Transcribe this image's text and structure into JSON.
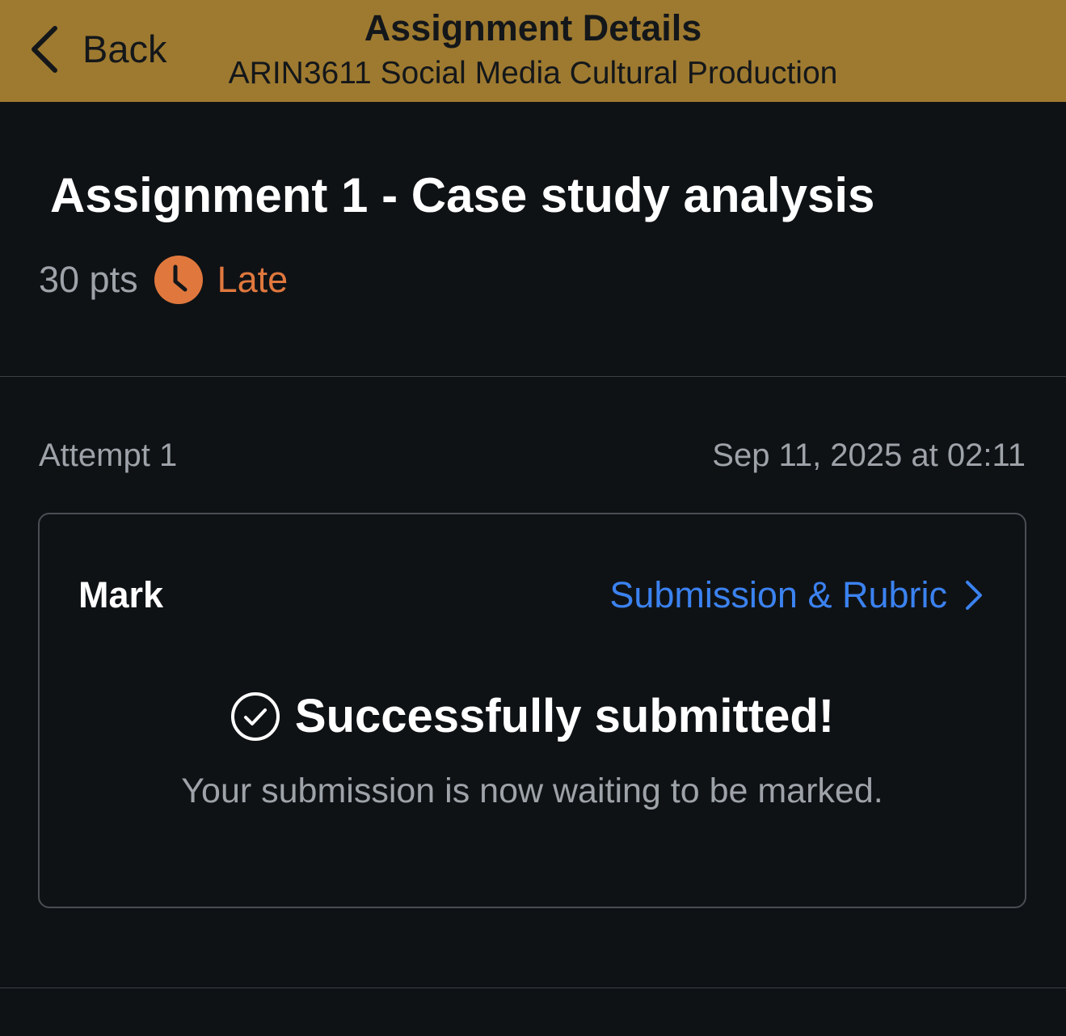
{
  "nav": {
    "back_label": "Back",
    "title": "Assignment Details",
    "subtitle": "ARIN3611 Social Media Cultural Production",
    "background_color": "#9e7a30",
    "back_icon": "chevron-left-icon"
  },
  "assignment": {
    "title": "Assignment 1 - Case study analysis",
    "points": "30 pts",
    "status": "Late",
    "status_icon": "clock-icon",
    "status_color": "#e0783e"
  },
  "attempt": {
    "label": "Attempt 1",
    "date": "Sep 11, 2025 at 02:11"
  },
  "card": {
    "mark_label": "Mark",
    "link_label": "Submission & Rubric",
    "link_icon": "chevron-right-icon",
    "link_color": "#3b82f0",
    "success_title": "Successfully submitted!",
    "success_icon": "check-circle-icon",
    "success_subtitle": "Your submission is now waiting to be marked."
  }
}
